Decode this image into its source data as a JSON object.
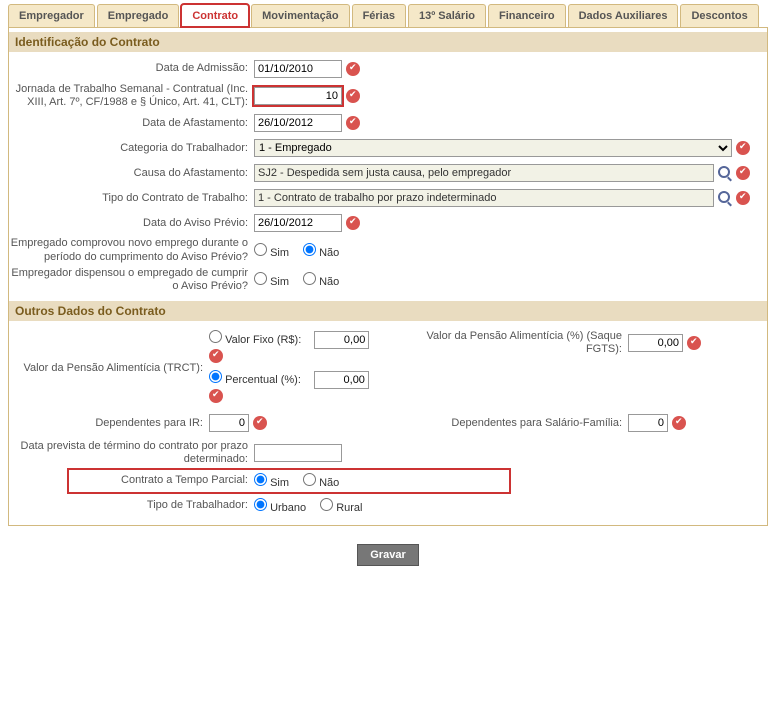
{
  "tabs": [
    "Empregador",
    "Empregado",
    "Contrato",
    "Movimentação",
    "Férias",
    "13º Salário",
    "Financeiro",
    "Dados Auxiliares",
    "Descontos"
  ],
  "active_tab": "Contrato",
  "s1": {
    "title": "Identificação do Contrato",
    "l_adm": "Data de Admissão:",
    "v_adm": "01/10/2010",
    "l_jor": "Jornada de Trabalho Semanal - Contratual (Inc. XIII, Art. 7º, CF/1988 e § Único, Art. 41, CLT):",
    "v_jor": "10",
    "l_afa": "Data de Afastamento:",
    "v_afa": "26/10/2012",
    "l_cat": "Categoria do Trabalhador:",
    "v_cat": "1 - Empregado",
    "l_cau": "Causa do Afastamento:",
    "v_cau": "SJ2 - Despedida sem justa causa, pelo empregador",
    "l_tip": "Tipo do Contrato de Trabalho:",
    "v_tip": "1 - Contrato de trabalho por prazo indeterminado",
    "l_avi": "Data do Aviso Prévio:",
    "v_avi": "26/10/2012",
    "l_emp1": "Empregado comprovou novo emprego durante o período do cumprimento do Aviso Prévio?",
    "sim": "Sim",
    "nao": "Não",
    "l_emp2": "Empregador dispensou o empregado de cumprir o Aviso Prévio?"
  },
  "s2": {
    "title": "Outros Dados do Contrato",
    "l_pen": "Valor da Pensão Alimentícia (TRCT):",
    "l_fix": "Valor Fixo (R$):",
    "v_fix": "0,00",
    "l_per": "Percentual (%):",
    "v_per": "0,00",
    "l_pfg": "Valor da Pensão Alimentícia (%) (Saque FGTS):",
    "v_pfg": "0,00",
    "l_dir": "Dependentes para IR:",
    "v_dir": "0",
    "l_dsf": "Dependentes para Salário-Família:",
    "v_dsf": "0",
    "l_dtp": "Data prevista de término do contrato por prazo determinado:",
    "v_dtp": "",
    "l_ctp": "Contrato a Tempo Parcial:",
    "sim": "Sim",
    "nao": "Não",
    "l_ttr": "Tipo de Trabalhador:",
    "urb": "Urbano",
    "rur": "Rural"
  },
  "btn_save": "Gravar"
}
